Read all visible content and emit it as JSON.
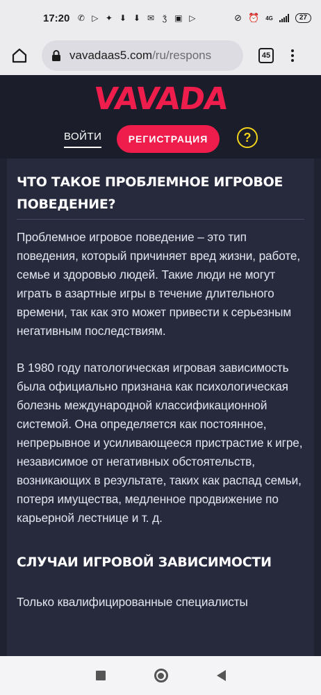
{
  "status_bar": {
    "time": "17:20",
    "left_icons": [
      "whatsapp-icon",
      "play-icon",
      "sparkle-icon",
      "download-icon",
      "download-icon",
      "mail-icon",
      "notification-icon",
      "camera-icon",
      "play-icon"
    ],
    "network_label": "4G",
    "battery": "27"
  },
  "browser": {
    "url_host": "vavadaas5.com",
    "url_path": "/ru/respons",
    "tab_count": "45"
  },
  "header": {
    "logo": "VAVADA",
    "login_label": "ВОЙТИ",
    "register_label": "РЕГИСТРАЦИЯ",
    "help_label": "?",
    "brand_color": "#ee1d4c",
    "help_color": "#f2d21a"
  },
  "article": {
    "heading_1": "ЧТО ТАКОЕ ПРОБЛЕМНОЕ ИГРОВОЕ ПОВЕДЕНИЕ?",
    "paragraph_1": "Проблемное игровое поведение – это тип поведения, который причиняет вред жизни, работе, семье и здоровью людей. Такие люди не могут играть в азартные игры в течение длительного времени, так как это может привести к серьезным негативным последствиям.",
    "paragraph_2": "В 1980 году патологическая игровая зависимость была официально признана как психологическая болезнь международной классификационной системой. Она определяется как постоянное, непрерывное и усиливающееся пристрастие к игре, независимое от негативных обстоятельств, возникающих в результате, таких как распад семьи, потеря имущества, медленное продвижение по карьерной лестнице и т. д.",
    "heading_2": "СЛУЧАИ ИГРОВОЙ ЗАВИСИМОСТИ",
    "paragraph_3": "Только квалифицированные специалисты"
  }
}
